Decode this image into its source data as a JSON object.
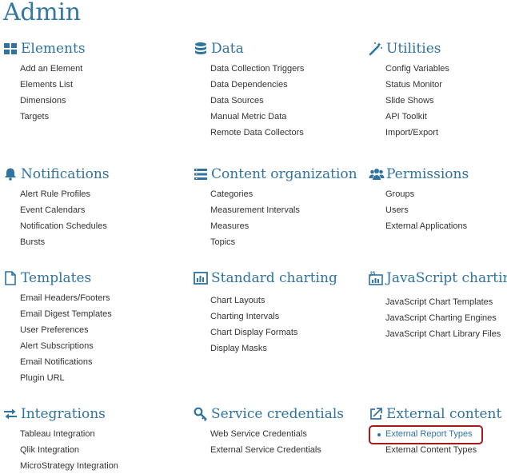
{
  "page": {
    "title": "Admin"
  },
  "colors": {
    "accent": "#2f73a0",
    "text": "#333333",
    "highlight": "#a51b1b"
  },
  "sections": {
    "elements": {
      "title": "Elements",
      "icon": "grid-icon",
      "links": [
        "Add an Element",
        "Elements List",
        "Dimensions",
        "Targets"
      ]
    },
    "data": {
      "title": "Data",
      "icon": "database-icon",
      "links": [
        "Data Collection Triggers",
        "Data Dependencies",
        "Data Sources",
        "Manual Metric Data",
        "Remote Data Collectors"
      ]
    },
    "utilities": {
      "title": "Utilities",
      "icon": "magic-wand-icon",
      "links": [
        "Config Variables",
        "Status Monitor",
        "Slide Shows",
        "API Toolkit",
        "Import/Export"
      ]
    },
    "notifications": {
      "title": "Notifications",
      "icon": "bell-icon",
      "links": [
        "Alert Rule Profiles",
        "Event Calendars",
        "Notification Schedules",
        "Bursts"
      ]
    },
    "content_organization": {
      "title": "Content organization",
      "icon": "list-icon",
      "links": [
        "Categories",
        "Measurement Intervals",
        "Measures",
        "Topics"
      ]
    },
    "permissions": {
      "title": "Permissions",
      "icon": "users-icon",
      "links": [
        "Groups",
        "Users",
        "External Applications"
      ]
    },
    "templates": {
      "title": "Templates",
      "icon": "document-icon",
      "links": [
        "Email Headers/Footers",
        "Email Digest Templates",
        "User Preferences",
        "Alert Subscriptions",
        "Email Notifications",
        "Plugin URL"
      ]
    },
    "standard_charting": {
      "title": "Standard charting",
      "icon": "bar-chart-icon",
      "links": [
        "Chart Layouts",
        "Charting Intervals",
        "Chart Display Formats",
        "Display Masks"
      ]
    },
    "javascript_charting": {
      "title": "JavaScript charting",
      "icon": "js-chart-icon",
      "icon_label": "JS",
      "links": [
        "JavaScript Chart Templates",
        "JavaScript Charting Engines",
        "JavaScript Chart Library Files"
      ]
    },
    "integrations": {
      "title": "Integrations",
      "icon": "exchange-arrows-icon",
      "links": [
        "Tableau Integration",
        "Qlik Integration",
        "MicroStrategy Integration"
      ]
    },
    "service_credentials": {
      "title": "Service credentials",
      "icon": "key-icon",
      "links": [
        "Web Service Credentials",
        "External Service Credentials"
      ]
    },
    "external_content": {
      "title": "External content",
      "icon": "external-link-icon",
      "links": [
        "External Report Types",
        "External Content Types"
      ]
    }
  }
}
